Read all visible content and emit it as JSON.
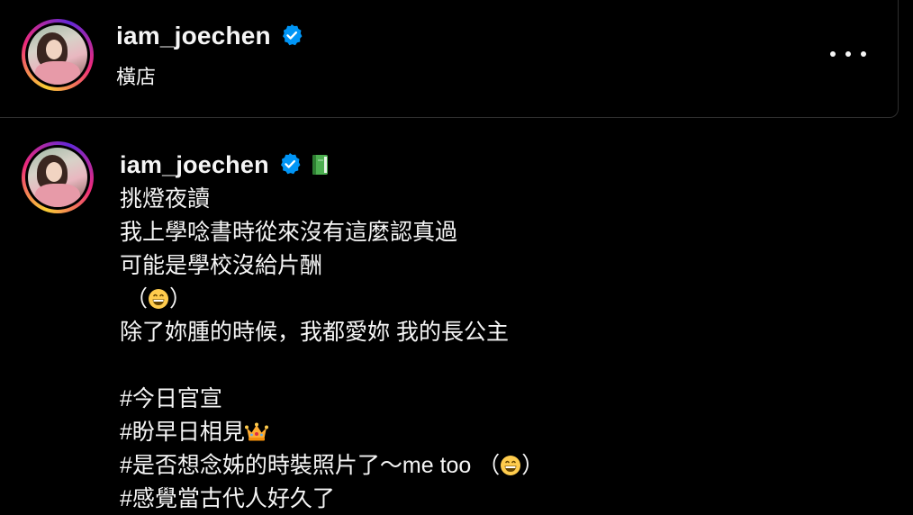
{
  "header": {
    "username": "iam_joechen",
    "location": "橫店",
    "more_icon": "more-horizontal-icon"
  },
  "post": {
    "username": "iam_joechen",
    "username_emoji": "green-book-icon",
    "caption": {
      "line1": "挑燈夜讀",
      "line2": "我上學唸書時從來沒有這麼認真過",
      "line3": "可能是學校沒給片酬",
      "line4_open": "（",
      "line4_close": "）",
      "line5": "除了妳腫的時候，我都愛妳 我的長公主",
      "hashtag1": "#今日官宣",
      "hashtag2": "#盼早日相見",
      "hashtag3": "#是否想念姊的時裝照片了～me too （",
      "hashtag3_close": "）",
      "hashtag4": "#感覺當古代人好久了"
    }
  },
  "colors": {
    "background": "#000000",
    "text": "#f5f5f5",
    "verified_blue": "#0095f6",
    "divider": "#2e2e2e"
  }
}
